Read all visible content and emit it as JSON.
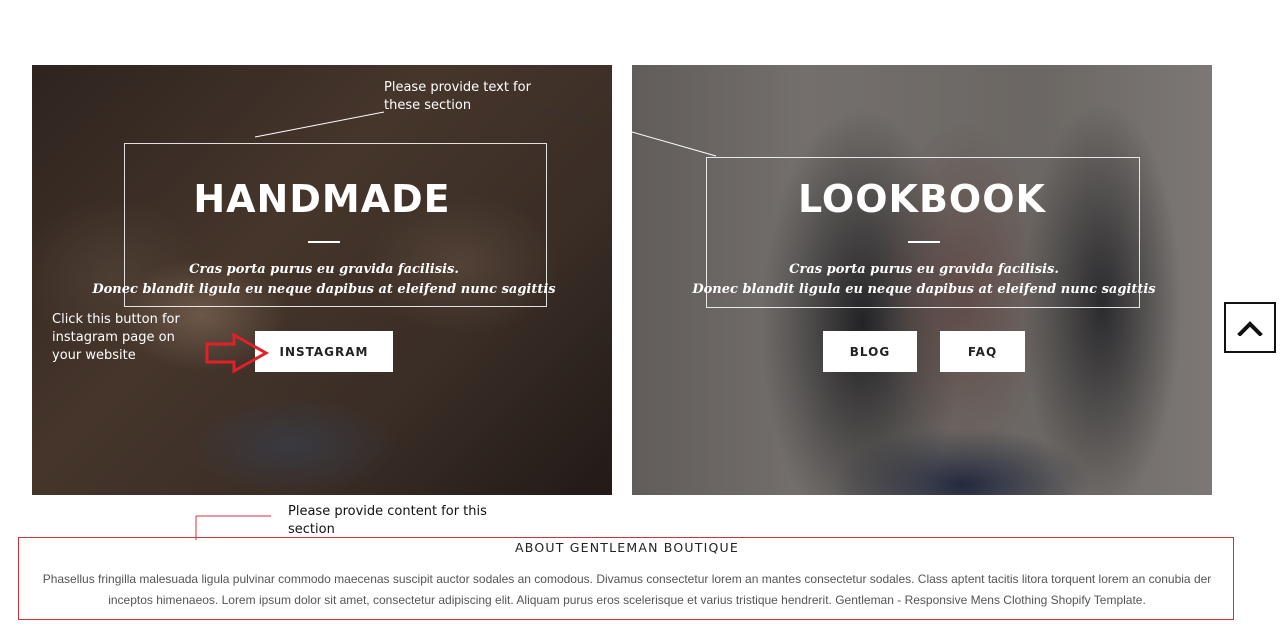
{
  "left_panel": {
    "heading": "HANDMADE",
    "tagline_line1": "Cras porta purus eu gravida facilisis.",
    "tagline_line2": "Donec blandit ligula eu neque dapibus at eleifend nunc sagittis",
    "button_label": "INSTAGRAM"
  },
  "right_panel": {
    "heading": "LOOKBOOK",
    "tagline_line1": "Cras porta purus eu gravida facilisis.",
    "tagline_line2": "Donec blandit ligula eu neque dapibus at eleifend nunc sagittis",
    "blog_label": "BLOG",
    "faq_label": "FAQ"
  },
  "annotations": {
    "section_text_note": "Please provide text for these section",
    "instagram_note": "Click this button for instagram page on your website",
    "content_note": "Please provide content for this section",
    "arrow_color": "#e0202a",
    "box_color": "#d0323b"
  },
  "about": {
    "title": "ABOUT GENTLEMAN BOUTIQUE",
    "body": "Phasellus fringilla malesuada ligula pulvinar commodo maecenas suscipit auctor sodales an comodous. Divamus consectetur lorem an mantes consectetur sodales. Class aptent tacitis litora torquent lorem an conubia der inceptos himenaeos. Lorem ipsum dolor sit amet, consectetur adipiscing elit. Aliquam purus eros scelerisque et varius tristique hendrerit. Gentleman - Responsive Mens Clothing Shopify Template."
  },
  "scroll_top": {
    "icon": "chevron-up-icon"
  }
}
